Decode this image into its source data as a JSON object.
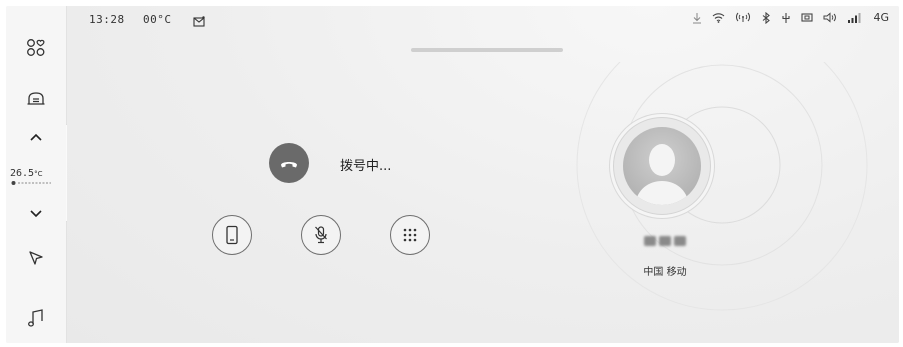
{
  "status_bar": {
    "time": "13:28",
    "outside_temp": "00°C",
    "network": "4G"
  },
  "sidebar": {
    "temperature_value": "26.5",
    "temperature_unit": "°C"
  },
  "call": {
    "status": "拨号中...",
    "carrier": "中国 移动"
  },
  "icons": {
    "sidebar": [
      "apps-icon",
      "car-icon",
      "chevron-up-icon",
      "chevron-down-icon",
      "navigation-icon",
      "music-icon"
    ],
    "status_right": [
      "download-icon",
      "wifi-icon",
      "hotspot-icon",
      "bluetooth-icon",
      "usb-icon",
      "camera-icon",
      "volume-icon",
      "signal-icon"
    ],
    "controls": [
      "phone-handset-icon",
      "mic-mute-icon",
      "dialpad-icon"
    ]
  },
  "colors": {
    "hangup_button": "#6a6a6a",
    "background": "#efefef"
  }
}
